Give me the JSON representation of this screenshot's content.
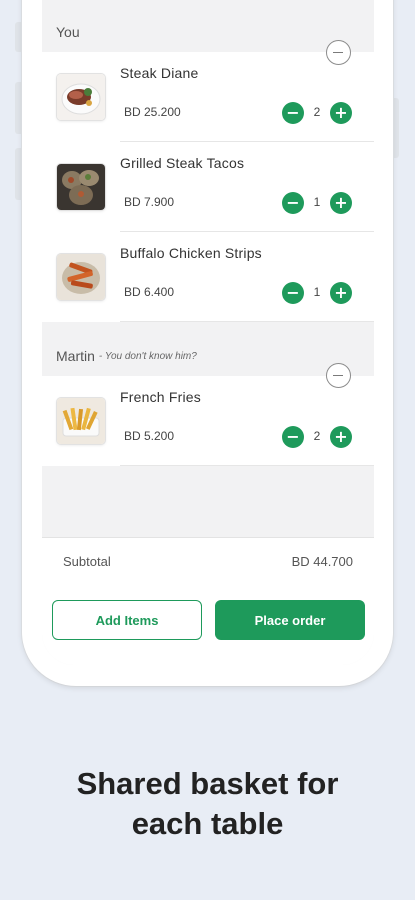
{
  "basket": {
    "groups": [
      {
        "owner": "You",
        "note": "",
        "items": [
          {
            "name": "Steak Diane",
            "price": "BD 25.200",
            "qty": "2"
          },
          {
            "name": "Grilled Steak Tacos",
            "price": "BD 7.900",
            "qty": "1"
          },
          {
            "name": "Buffalo Chicken Strips",
            "price": "BD 6.400",
            "qty": "1"
          }
        ]
      },
      {
        "owner": "Martin",
        "note": "- You don't know him?",
        "items": [
          {
            "name": "French Fries",
            "price": "BD 5.200",
            "qty": "2"
          }
        ]
      }
    ],
    "subtotal_label": "Subtotal",
    "subtotal_value": "BD 44.700",
    "add_items_label": "Add Items",
    "place_order_label": "Place order"
  },
  "caption": {
    "line1": "Shared basket for",
    "line2": "each table"
  },
  "icons": {
    "remove": "minus-circle-icon",
    "decrement": "minus-icon",
    "increment": "plus-icon"
  },
  "colors": {
    "accent": "#1e9a5b",
    "background": "#e8edf5"
  }
}
